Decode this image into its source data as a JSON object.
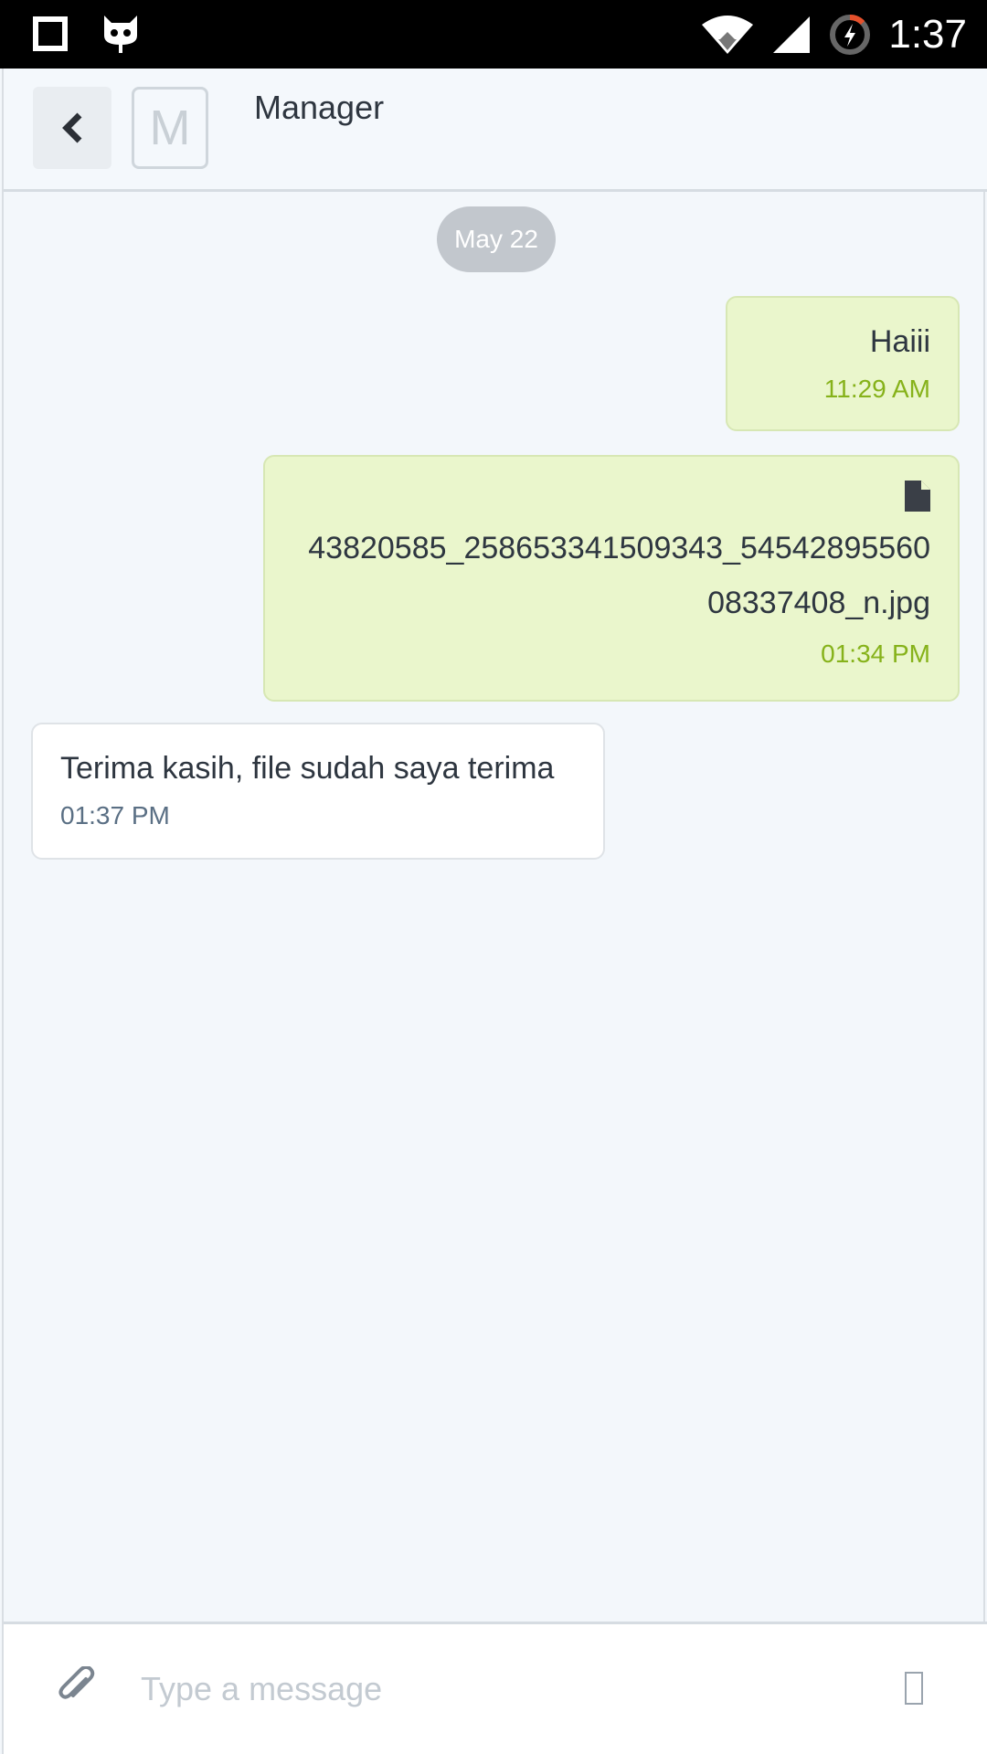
{
  "status_bar": {
    "time": "1:37",
    "icons": [
      "stop-square-icon",
      "cat-face-icon",
      "wifi-icon",
      "signal-icon",
      "battery-charging-icon"
    ]
  },
  "header": {
    "back_icon": "chevron-left-icon",
    "avatar_letter": "M",
    "title": "Manager"
  },
  "conversation": {
    "date_label": "May 22",
    "messages": [
      {
        "direction": "outgoing",
        "text": "Haiii",
        "time": "11:29 AM"
      },
      {
        "direction": "outgoing",
        "type": "file",
        "icon": "file-icon",
        "text": "43820585_258653341509343_5454289556008337408_n.jpg",
        "time": "01:34 PM"
      },
      {
        "direction": "incoming",
        "text": "Terima kasih, file sudah saya terima",
        "time": "01:37 PM"
      }
    ]
  },
  "composer": {
    "attach_icon": "paperclip-icon",
    "placeholder": "Type a message",
    "send_icon": "send-icon"
  },
  "colors": {
    "outgoing_bubble": "#eaf6cc",
    "outgoing_time": "#86b21a",
    "incoming_time": "#5a6f84",
    "date_pill": "#c2c7cd"
  }
}
